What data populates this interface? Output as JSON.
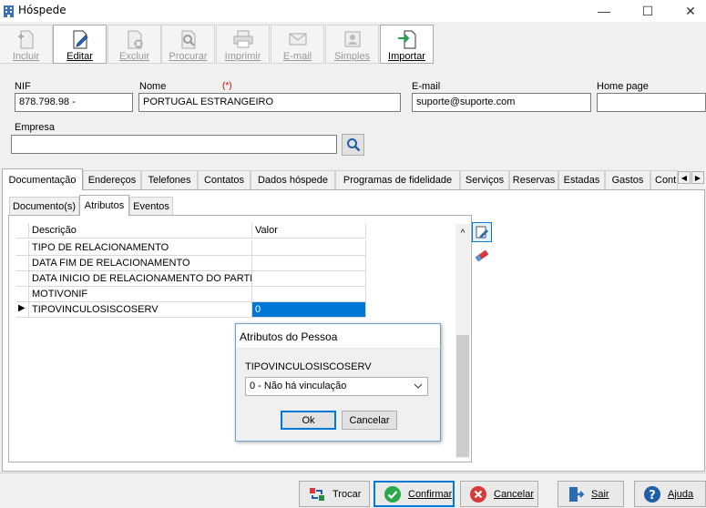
{
  "window": {
    "title": "Hóspede",
    "minimize_glyph": "—",
    "maximize_glyph": "☐",
    "close_glyph": "✕"
  },
  "toolbar": {
    "incluir": "Incluir",
    "editar": "Editar",
    "excluir": "Excluir",
    "procurar": "Procurar",
    "imprimir": "Imprimir",
    "email": "E-mail",
    "simples": "Simples",
    "importar": "Importar"
  },
  "form": {
    "nif_label": "NIF",
    "nif_value": "878.798.98 -",
    "nome_label": "Nome",
    "nome_required": "(*)",
    "nome_value": "PORTUGAL ESTRANGEIRO",
    "email_label": "E-mail",
    "email_value": "suporte@suporte.com",
    "homepage_label": "Home page",
    "homepage_value": "",
    "empresa_label": "Empresa",
    "empresa_value": ""
  },
  "tabs": [
    {
      "label": "Documentação"
    },
    {
      "label": "Endereços"
    },
    {
      "label": "Telefones"
    },
    {
      "label": "Contatos"
    },
    {
      "label": "Dados hóspede"
    },
    {
      "label": "Programas de fidelidade"
    },
    {
      "label": "Serviços"
    },
    {
      "label": "Reservas"
    },
    {
      "label": "Estadas"
    },
    {
      "label": "Gastos"
    },
    {
      "label": "Cont"
    }
  ],
  "subtabs": [
    {
      "label": "Documento(s)"
    },
    {
      "label": "Atributos"
    },
    {
      "label": "Eventos"
    }
  ],
  "grid": {
    "headers": {
      "descricao": "Descrição",
      "valor": "Valor"
    },
    "current_marker": "▶",
    "rows": [
      {
        "descricao": "TIPO DE RELACIONAMENTO",
        "valor": ""
      },
      {
        "descricao": "DATA FIM DE RELACIONAMENTO",
        "valor": ""
      },
      {
        "descricao": "DATA INICIO DE RELACIONAMENTO DO PARTICIPANTE",
        "valor": ""
      },
      {
        "descricao": "MOTIVONIF",
        "valor": ""
      },
      {
        "descricao": "TIPOVINCULOSISCOSERV",
        "valor": "0"
      }
    ],
    "scroll_up_glyph": "^"
  },
  "dialog": {
    "title": "Atributos do Pessoa",
    "field_label": "TIPOVINCULOSISCOSERV",
    "select_value": "0 - Não há vinculação",
    "ok": "Ok",
    "cancel": "Cancelar"
  },
  "bottom": {
    "trocar": "Trocar",
    "confirmar": "Confirmar",
    "cancelar": "Cancelar",
    "sair": "Sair",
    "ajuda": "Ajuda"
  },
  "colors": {
    "accent": "#0078d7",
    "required": "#d00000"
  }
}
